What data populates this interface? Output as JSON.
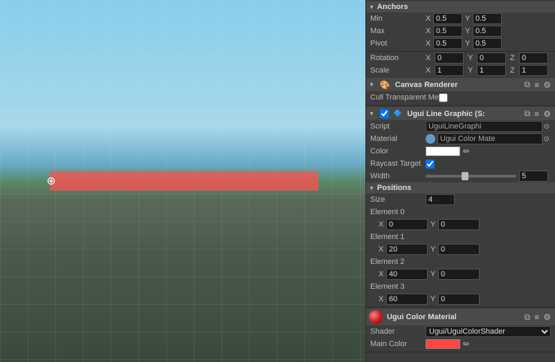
{
  "viewport": {
    "label": "Viewport"
  },
  "inspector": {
    "anchors": {
      "header": "Anchors",
      "min_label": "Min",
      "min_x": "0.5",
      "min_y": "0.5",
      "max_label": "Max",
      "max_x": "0.5",
      "max_y": "0.5",
      "pivot_label": "Pivot",
      "pivot_x": "0.5",
      "pivot_y": "0.5"
    },
    "rotation": {
      "header": "Rotation",
      "x": "0",
      "y": "0",
      "z": "0"
    },
    "scale": {
      "header": "Scale",
      "x": "1",
      "y": "1",
      "z": "1"
    },
    "canvas_renderer": {
      "header": "Canvas Renderer",
      "cull_label": "Cull Transparent Me"
    },
    "ugui_line": {
      "header": "Ugui Line Graphic (S:",
      "script_label": "Script",
      "script_value": "UguiLineGraphi",
      "material_label": "Material",
      "material_value": "Ugui Color Mate",
      "color_label": "Color",
      "raycast_label": "Raycast Target",
      "width_label": "Width",
      "width_value": "5",
      "positions_label": "Positions",
      "size_label": "Size",
      "size_value": "4",
      "element0_label": "Element 0",
      "e0_x": "0",
      "e0_y": "0",
      "element1_label": "Element 1",
      "e1_x": "20",
      "e1_y": "0",
      "element2_label": "Element 2",
      "e2_x": "40",
      "e2_y": "0",
      "element3_label": "Element 3",
      "e3_x": "60",
      "e3_y": "0"
    },
    "ugui_color_material": {
      "header": "Ugui Color Material",
      "shader_label": "Shader",
      "shader_value": "Ugui/UguiColorShader",
      "main_color_label": "Main Color"
    }
  }
}
